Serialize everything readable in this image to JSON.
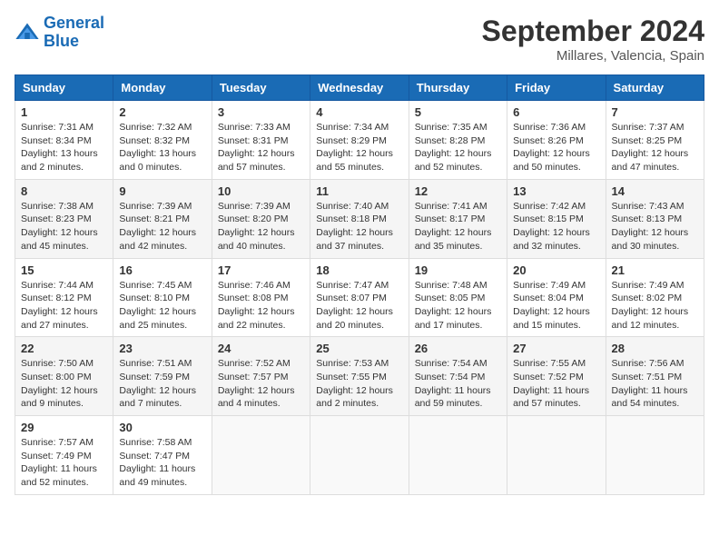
{
  "header": {
    "logo_line1": "General",
    "logo_line2": "Blue",
    "month": "September 2024",
    "location": "Millares, Valencia, Spain"
  },
  "days_of_week": [
    "Sunday",
    "Monday",
    "Tuesday",
    "Wednesday",
    "Thursday",
    "Friday",
    "Saturday"
  ],
  "weeks": [
    [
      {
        "day": "1",
        "lines": [
          "Sunrise: 7:31 AM",
          "Sunset: 8:34 PM",
          "Daylight: 13 hours",
          "and 2 minutes."
        ]
      },
      {
        "day": "2",
        "lines": [
          "Sunrise: 7:32 AM",
          "Sunset: 8:32 PM",
          "Daylight: 13 hours",
          "and 0 minutes."
        ]
      },
      {
        "day": "3",
        "lines": [
          "Sunrise: 7:33 AM",
          "Sunset: 8:31 PM",
          "Daylight: 12 hours",
          "and 57 minutes."
        ]
      },
      {
        "day": "4",
        "lines": [
          "Sunrise: 7:34 AM",
          "Sunset: 8:29 PM",
          "Daylight: 12 hours",
          "and 55 minutes."
        ]
      },
      {
        "day": "5",
        "lines": [
          "Sunrise: 7:35 AM",
          "Sunset: 8:28 PM",
          "Daylight: 12 hours",
          "and 52 minutes."
        ]
      },
      {
        "day": "6",
        "lines": [
          "Sunrise: 7:36 AM",
          "Sunset: 8:26 PM",
          "Daylight: 12 hours",
          "and 50 minutes."
        ]
      },
      {
        "day": "7",
        "lines": [
          "Sunrise: 7:37 AM",
          "Sunset: 8:25 PM",
          "Daylight: 12 hours",
          "and 47 minutes."
        ]
      }
    ],
    [
      {
        "day": "8",
        "lines": [
          "Sunrise: 7:38 AM",
          "Sunset: 8:23 PM",
          "Daylight: 12 hours",
          "and 45 minutes."
        ]
      },
      {
        "day": "9",
        "lines": [
          "Sunrise: 7:39 AM",
          "Sunset: 8:21 PM",
          "Daylight: 12 hours",
          "and 42 minutes."
        ]
      },
      {
        "day": "10",
        "lines": [
          "Sunrise: 7:39 AM",
          "Sunset: 8:20 PM",
          "Daylight: 12 hours",
          "and 40 minutes."
        ]
      },
      {
        "day": "11",
        "lines": [
          "Sunrise: 7:40 AM",
          "Sunset: 8:18 PM",
          "Daylight: 12 hours",
          "and 37 minutes."
        ]
      },
      {
        "day": "12",
        "lines": [
          "Sunrise: 7:41 AM",
          "Sunset: 8:17 PM",
          "Daylight: 12 hours",
          "and 35 minutes."
        ]
      },
      {
        "day": "13",
        "lines": [
          "Sunrise: 7:42 AM",
          "Sunset: 8:15 PM",
          "Daylight: 12 hours",
          "and 32 minutes."
        ]
      },
      {
        "day": "14",
        "lines": [
          "Sunrise: 7:43 AM",
          "Sunset: 8:13 PM",
          "Daylight: 12 hours",
          "and 30 minutes."
        ]
      }
    ],
    [
      {
        "day": "15",
        "lines": [
          "Sunrise: 7:44 AM",
          "Sunset: 8:12 PM",
          "Daylight: 12 hours",
          "and 27 minutes."
        ]
      },
      {
        "day": "16",
        "lines": [
          "Sunrise: 7:45 AM",
          "Sunset: 8:10 PM",
          "Daylight: 12 hours",
          "and 25 minutes."
        ]
      },
      {
        "day": "17",
        "lines": [
          "Sunrise: 7:46 AM",
          "Sunset: 8:08 PM",
          "Daylight: 12 hours",
          "and 22 minutes."
        ]
      },
      {
        "day": "18",
        "lines": [
          "Sunrise: 7:47 AM",
          "Sunset: 8:07 PM",
          "Daylight: 12 hours",
          "and 20 minutes."
        ]
      },
      {
        "day": "19",
        "lines": [
          "Sunrise: 7:48 AM",
          "Sunset: 8:05 PM",
          "Daylight: 12 hours",
          "and 17 minutes."
        ]
      },
      {
        "day": "20",
        "lines": [
          "Sunrise: 7:49 AM",
          "Sunset: 8:04 PM",
          "Daylight: 12 hours",
          "and 15 minutes."
        ]
      },
      {
        "day": "21",
        "lines": [
          "Sunrise: 7:49 AM",
          "Sunset: 8:02 PM",
          "Daylight: 12 hours",
          "and 12 minutes."
        ]
      }
    ],
    [
      {
        "day": "22",
        "lines": [
          "Sunrise: 7:50 AM",
          "Sunset: 8:00 PM",
          "Daylight: 12 hours",
          "and 9 minutes."
        ]
      },
      {
        "day": "23",
        "lines": [
          "Sunrise: 7:51 AM",
          "Sunset: 7:59 PM",
          "Daylight: 12 hours",
          "and 7 minutes."
        ]
      },
      {
        "day": "24",
        "lines": [
          "Sunrise: 7:52 AM",
          "Sunset: 7:57 PM",
          "Daylight: 12 hours",
          "and 4 minutes."
        ]
      },
      {
        "day": "25",
        "lines": [
          "Sunrise: 7:53 AM",
          "Sunset: 7:55 PM",
          "Daylight: 12 hours",
          "and 2 minutes."
        ]
      },
      {
        "day": "26",
        "lines": [
          "Sunrise: 7:54 AM",
          "Sunset: 7:54 PM",
          "Daylight: 11 hours",
          "and 59 minutes."
        ]
      },
      {
        "day": "27",
        "lines": [
          "Sunrise: 7:55 AM",
          "Sunset: 7:52 PM",
          "Daylight: 11 hours",
          "and 57 minutes."
        ]
      },
      {
        "day": "28",
        "lines": [
          "Sunrise: 7:56 AM",
          "Sunset: 7:51 PM",
          "Daylight: 11 hours",
          "and 54 minutes."
        ]
      }
    ],
    [
      {
        "day": "29",
        "lines": [
          "Sunrise: 7:57 AM",
          "Sunset: 7:49 PM",
          "Daylight: 11 hours",
          "and 52 minutes."
        ]
      },
      {
        "day": "30",
        "lines": [
          "Sunrise: 7:58 AM",
          "Sunset: 7:47 PM",
          "Daylight: 11 hours",
          "and 49 minutes."
        ]
      },
      null,
      null,
      null,
      null,
      null
    ]
  ]
}
